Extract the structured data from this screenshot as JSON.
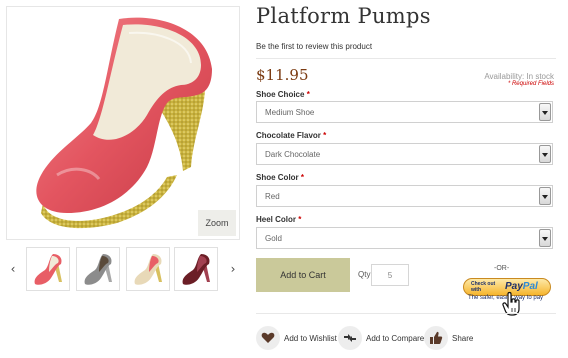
{
  "product": {
    "title": "Platform Pumps",
    "review_link": "Be the first to review this product",
    "price": "$11.95",
    "availability": "Availability: In stock",
    "required_note": "* Required Fields"
  },
  "gallery": {
    "zoom_label": "Zoom",
    "prev_icon": "chevron-left-icon",
    "next_icon": "chevron-right-icon",
    "thumbnails": [
      {
        "heel_color": "#d8c060",
        "upper_color": "#e85e66"
      },
      {
        "heel_color": "#a8a8a8",
        "upper_color": "#8c8c8c"
      },
      {
        "heel_color": "#d8c060",
        "upper_color": "#e8d9b8"
      },
      {
        "heel_color": "#a24050",
        "upper_color": "#6b1e26"
      }
    ]
  },
  "options": [
    {
      "label": "Shoe Choice",
      "required_mark": "*",
      "value": "Medium Shoe"
    },
    {
      "label": "Chocolate Flavor",
      "required_mark": "*",
      "value": "Dark Chocolate"
    },
    {
      "label": "Shoe Color",
      "required_mark": "*",
      "value": "Red"
    },
    {
      "label": "Heel Color",
      "required_mark": "*",
      "value": "Gold"
    }
  ],
  "cart": {
    "add_to_cart_label": "Add to Cart",
    "qty_label": "Qty:",
    "qty_value": "5",
    "or_text": "-OR-",
    "paypal_checkout_text": "Check out with",
    "paypal_brand_1": "Pay",
    "paypal_brand_2": "Pal",
    "paypal_tagline": "The safer, easier way to pay"
  },
  "actions": [
    {
      "label": "Add to Wishlist",
      "icon": "heart-icon"
    },
    {
      "label": "Add to Compare",
      "icon": "compare-arrows-icon"
    },
    {
      "label": "Share",
      "icon": "thumbs-up-icon"
    }
  ],
  "colors": {
    "price": "#7b3b12",
    "add_to_cart_bg": "#cac99a",
    "required": "#cc0000",
    "shoe_red": "#e85e66",
    "glitter_gold": "#d6c45a"
  }
}
